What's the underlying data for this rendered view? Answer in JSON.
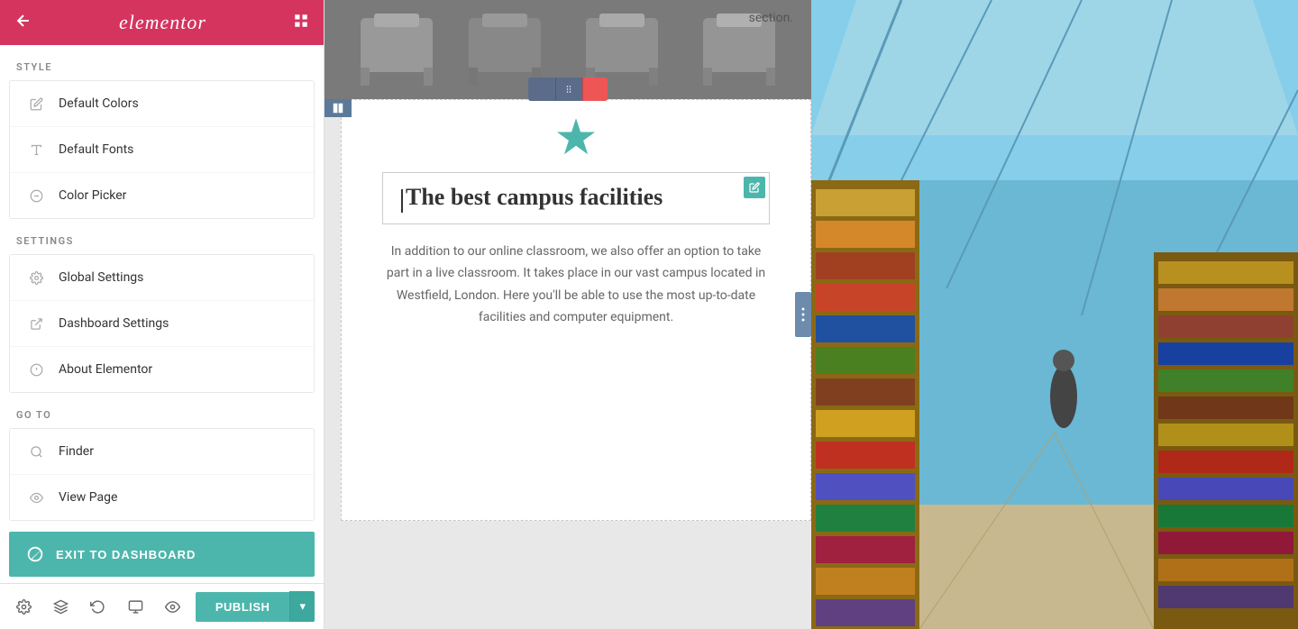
{
  "header": {
    "logo": "elementor",
    "back_label": "←",
    "grid_label": "⊞"
  },
  "sidebar": {
    "style_label": "STYLE",
    "settings_label": "SETTINGS",
    "goto_label": "GO TO",
    "style_items": [
      {
        "id": "default-colors",
        "label": "Default Colors",
        "icon": "pencil-icon"
      },
      {
        "id": "default-fonts",
        "label": "Default Fonts",
        "icon": "font-icon"
      },
      {
        "id": "color-picker",
        "label": "Color Picker",
        "icon": "eyedropper-icon"
      }
    ],
    "settings_items": [
      {
        "id": "global-settings",
        "label": "Global Settings",
        "icon": "gear-icon"
      },
      {
        "id": "dashboard-settings",
        "label": "Dashboard Settings",
        "icon": "external-link-icon"
      },
      {
        "id": "about-elementor",
        "label": "About Elementor",
        "icon": "info-icon"
      }
    ],
    "goto_items": [
      {
        "id": "finder",
        "label": "Finder",
        "icon": "search-icon"
      },
      {
        "id": "view-page",
        "label": "View Page",
        "icon": "eye-icon"
      }
    ],
    "exit_label": "EXIT TO DASHBOARD",
    "publish_label": "PUBLISH"
  },
  "canvas": {
    "section_label": "section.",
    "heading": "The best campus facilities",
    "body_text": "In addition to our online classroom, we also offer an option to take part in a live classroom. It takes place in our vast campus located in Westfield, London. Here you'll be able to use the most up-to-date facilities and computer equipment.",
    "star_char": "★"
  },
  "toolbar": {
    "add_icon": "+",
    "move_icon": "⠿",
    "close_icon": "×"
  },
  "footer": {
    "settings_icon": "⚙",
    "layers_icon": "☰",
    "history_icon": "↺",
    "device_icon": "☐",
    "view_icon": "👁",
    "publish_arrow": "▾"
  }
}
